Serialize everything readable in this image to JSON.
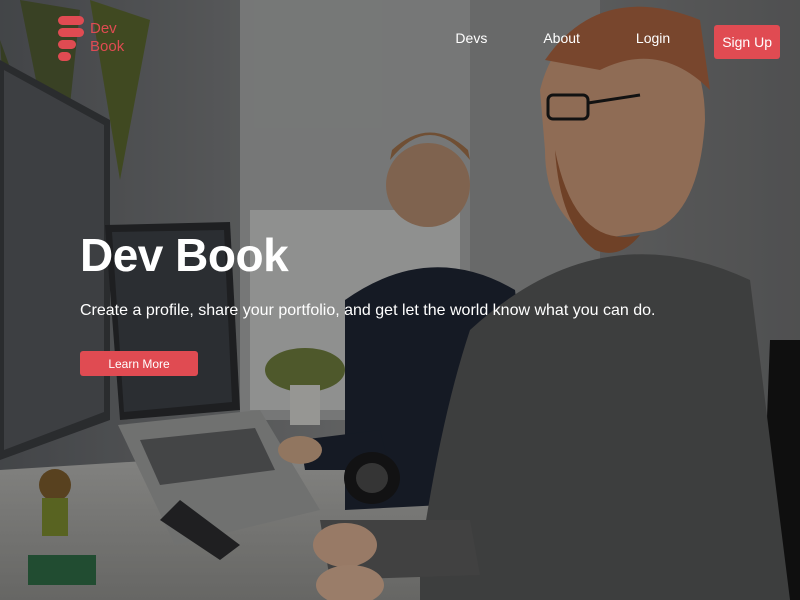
{
  "brand": {
    "line1": "Dev",
    "line2": "Book",
    "accent_color": "#e04b52",
    "icon": "stacked-bars-logo"
  },
  "nav": {
    "links": [
      "Devs",
      "About",
      "Login"
    ],
    "signup_label": "Sign Up"
  },
  "hero": {
    "title": "Dev Book",
    "subtitle": "Create a profile, share your portfolio, and get let the world know what you can do.",
    "cta_label": "Learn More",
    "background": "photo of developers working at laptops in an office"
  }
}
